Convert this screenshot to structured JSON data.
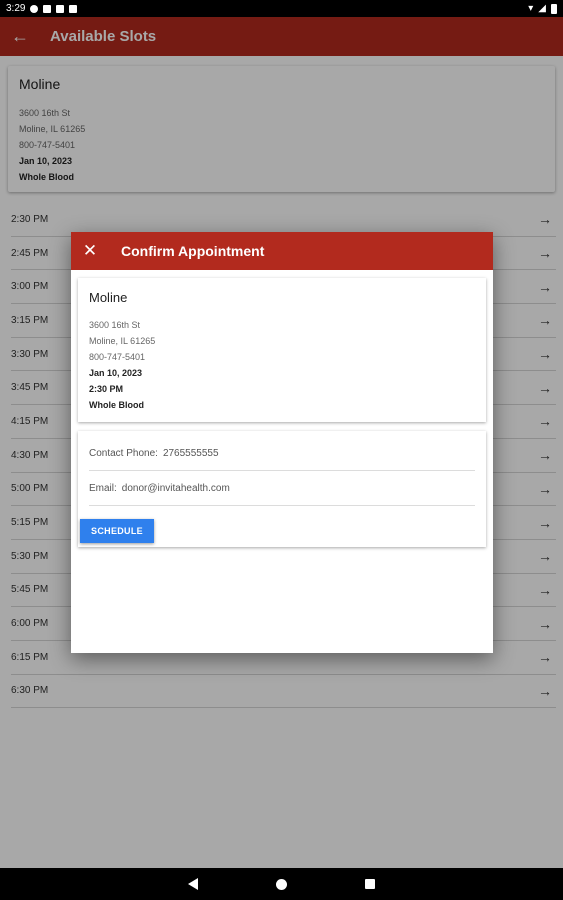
{
  "status_bar": {
    "time": "3:29"
  },
  "app_bar": {
    "title": "Available Slots",
    "back_icon": "arrow-left-icon"
  },
  "location": {
    "name": "Moline",
    "address1": "3600 16th St",
    "address2": "Moline, IL 61265",
    "phone": "800-747-5401",
    "date": "Jan 10, 2023",
    "type": "Whole Blood"
  },
  "slots": [
    "2:30 PM",
    "2:45 PM",
    "3:00 PM",
    "3:15 PM",
    "3:30 PM",
    "3:45 PM",
    "4:15 PM",
    "4:30 PM",
    "5:00 PM",
    "5:15 PM",
    "5:30 PM",
    "5:45 PM",
    "6:00 PM",
    "6:15 PM",
    "6:30 PM"
  ],
  "dialog": {
    "title": "Confirm Appointment",
    "name": "Moline",
    "address1": "3600 16th St",
    "address2": "Moline, IL 61265",
    "phone": "800-747-5401",
    "date": "Jan 10, 2023",
    "time": "2:30 PM",
    "type": "Whole Blood",
    "contact_label": "Contact Phone:",
    "contact_value": "2765555555",
    "email_label": "Email:",
    "email_value": "donor@invitahealth.com",
    "schedule_label": "SCHEDULE"
  },
  "colors": {
    "brand": "#b22a1e",
    "button": "#2f80ed"
  }
}
